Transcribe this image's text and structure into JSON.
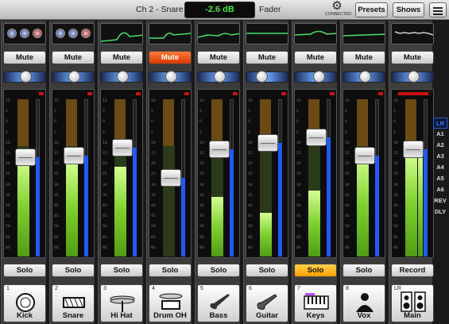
{
  "header": {
    "channel": "Ch 2 - Snare",
    "level": "-2.6 dB",
    "mode": "Fader",
    "connection_label": "CONNECTED",
    "presets_label": "Presets",
    "shows_label": "Shows"
  },
  "channels": [
    {
      "number": "1",
      "name": "Kick",
      "mute": "Mute",
      "solo": "Solo",
      "muted": false,
      "soloed": false,
      "icon": "kick-drum-icon",
      "fader_level": 0.63,
      "meter_level": 0.62,
      "pan": 0.5
    },
    {
      "number": "2",
      "name": "Snare",
      "mute": "Mute",
      "solo": "Solo",
      "muted": false,
      "soloed": false,
      "icon": "snare-drum-icon",
      "fader_level": 0.64,
      "meter_level": 0.6,
      "pan": 0.5
    },
    {
      "number": "3",
      "name": "Hi Hat",
      "mute": "Mute",
      "solo": "Solo",
      "muted": false,
      "soloed": false,
      "icon": "hihat-icon",
      "fader_level": 0.69,
      "meter_level": 0.57,
      "pan": 0.5
    },
    {
      "number": "4",
      "name": "Drum OH",
      "mute": "Mute",
      "solo": "Solo",
      "muted": true,
      "soloed": false,
      "icon": "drum-overhead-icon",
      "fader_level": 0.5,
      "meter_level": 0.0,
      "pan": 0.5
    },
    {
      "number": "5",
      "name": "Bass",
      "mute": "Mute",
      "solo": "Solo",
      "muted": false,
      "soloed": false,
      "icon": "bass-guitar-icon",
      "fader_level": 0.68,
      "meter_level": 0.38,
      "pan": 0.5
    },
    {
      "number": "6",
      "name": "Guitar",
      "mute": "Mute",
      "solo": "Solo",
      "muted": false,
      "soloed": false,
      "icon": "guitar-icon",
      "fader_level": 0.72,
      "meter_level": 0.28,
      "pan": 0.3
    },
    {
      "number": "7",
      "name": "Keys",
      "mute": "Mute",
      "solo": "Solo",
      "muted": false,
      "soloed": true,
      "icon": "keyboard-icon",
      "fader_level": 0.76,
      "meter_level": 0.42,
      "pan": 0.6
    },
    {
      "number": "8",
      "name": "Vox",
      "mute": "Mute",
      "solo": "Solo",
      "muted": false,
      "soloed": false,
      "icon": "vocalist-icon",
      "fader_level": 0.64,
      "meter_level": 0.64,
      "pan": 0.5
    }
  ],
  "main": {
    "number": "LR",
    "name": "Main",
    "mute": "Mute",
    "record": "Record",
    "icon": "speakers-icon",
    "fader_level": 0.68,
    "meter_level": 0.66,
    "pan": 0.5
  },
  "buses": [
    "LR",
    "A1",
    "A2",
    "A3",
    "A4",
    "A5",
    "A6",
    "REV",
    "DLY"
  ],
  "selected_bus": "LR",
  "scale_ticks": [
    "10",
    "5",
    "0",
    "5",
    "10",
    "15",
    "20",
    "25",
    "30",
    "35",
    "40",
    "45",
    "50",
    "60",
    "80"
  ],
  "colors": {
    "mute_active": "#e0430e",
    "solo_active": "#ffb300",
    "meter_green": "#7ed12a",
    "fader_blue": "#1e5aff",
    "level_green": "#49e649"
  }
}
